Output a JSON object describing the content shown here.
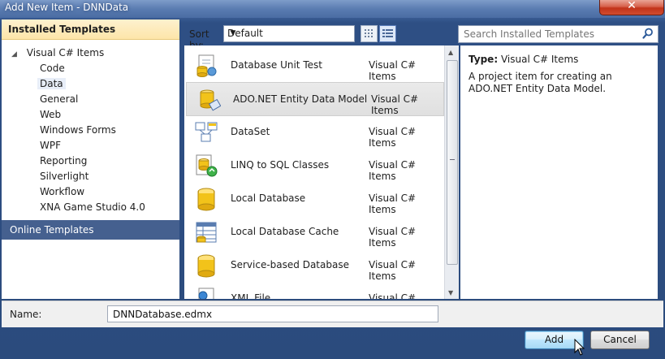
{
  "window": {
    "title": "Add New Item - DNNData",
    "close_glyph": "✕"
  },
  "left_panel": {
    "header": "Installed Templates",
    "root": {
      "arrow": "◢",
      "label": "Visual C# Items"
    },
    "items": [
      {
        "label": "Code"
      },
      {
        "label": "Data",
        "selected": true
      },
      {
        "label": "General"
      },
      {
        "label": "Web"
      },
      {
        "label": "Windows Forms"
      },
      {
        "label": "WPF"
      },
      {
        "label": "Reporting"
      },
      {
        "label": "Silverlight"
      },
      {
        "label": "Workflow"
      },
      {
        "label": "XNA Game Studio 4.0"
      }
    ],
    "online": "Online Templates"
  },
  "toolbar": {
    "sort_label": "Sort by:",
    "sort_value": "Default",
    "dropdown_glyph": "▼"
  },
  "search": {
    "placeholder": "Search Installed Templates"
  },
  "templates": [
    {
      "name": "Database Unit Test",
      "type": "Visual C# Items",
      "icon": "database-unit-test-icon"
    },
    {
      "name": "ADO.NET Entity Data Model",
      "type": "Visual C# Items",
      "icon": "entity-data-model-icon",
      "selected": true
    },
    {
      "name": "DataSet",
      "type": "Visual C# Items",
      "icon": "dataset-icon"
    },
    {
      "name": "LINQ to SQL Classes",
      "type": "Visual C# Items",
      "icon": "linq-to-sql-icon"
    },
    {
      "name": "Local Database",
      "type": "Visual C# Items",
      "icon": "database-icon"
    },
    {
      "name": "Local Database Cache",
      "type": "Visual C# Items",
      "icon": "database-cache-icon"
    },
    {
      "name": "Service-based Database",
      "type": "Visual C# Items",
      "icon": "database-icon"
    },
    {
      "name": "XML File",
      "type": "Visual C# Items",
      "icon": "xml-file-icon"
    }
  ],
  "scroll": {
    "up": "▲",
    "down": "▼"
  },
  "details": {
    "type_label": "Type:",
    "type_value": "Visual C# Items",
    "description": "A project item for creating an ADO.NET Entity Data Model."
  },
  "bottom": {
    "name_label": "Name:",
    "name_value": "DNNDatabase.edmx"
  },
  "buttons": {
    "add": "Add",
    "cancel": "Cancel"
  },
  "colors": {
    "window_frame": "#2b4b7d",
    "installed_header": "#fde5a9",
    "online_header": "#45608f",
    "selection": "#e0e0e0",
    "db_yellow": "#f2c31a"
  }
}
